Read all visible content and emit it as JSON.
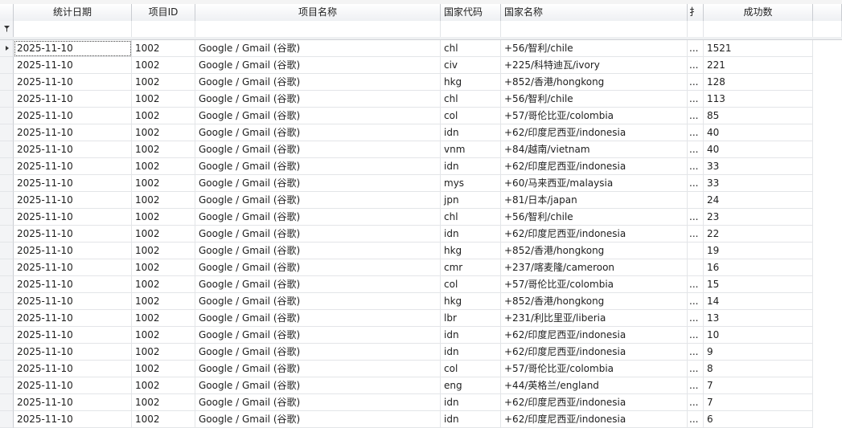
{
  "columns": [
    {
      "key": "date",
      "label": "统计日期"
    },
    {
      "key": "pid",
      "label": "项目ID"
    },
    {
      "key": "pname",
      "label": "项目名称"
    },
    {
      "key": "ccode",
      "label": "国家代码"
    },
    {
      "key": "cname",
      "label": "国家名称"
    },
    {
      "key": "trunc",
      "label": "扌"
    },
    {
      "key": "count",
      "label": "成功数"
    }
  ],
  "rows": [
    [
      "2025-11-10",
      "1002",
      "Google / Gmail (谷歌)",
      "chl",
      "+56/智利/chile",
      "...",
      "1521"
    ],
    [
      "2025-11-10",
      "1002",
      "Google / Gmail (谷歌)",
      "civ",
      "+225/科特迪瓦/ivory",
      "...",
      "221"
    ],
    [
      "2025-11-10",
      "1002",
      "Google / Gmail (谷歌)",
      "hkg",
      "+852/香港/hongkong",
      "...",
      "128"
    ],
    [
      "2025-11-10",
      "1002",
      "Google / Gmail (谷歌)",
      "chl",
      "+56/智利/chile",
      "...",
      "113"
    ],
    [
      "2025-11-10",
      "1002",
      "Google / Gmail (谷歌)",
      "col",
      "+57/哥伦比亚/colombia",
      "...",
      "85"
    ],
    [
      "2025-11-10",
      "1002",
      "Google / Gmail (谷歌)",
      "idn",
      "+62/印度尼西亚/indonesia",
      "...",
      "40"
    ],
    [
      "2025-11-10",
      "1002",
      "Google / Gmail (谷歌)",
      "vnm",
      "+84/越南/vietnam",
      "...",
      "40"
    ],
    [
      "2025-11-10",
      "1002",
      "Google / Gmail (谷歌)",
      "idn",
      "+62/印度尼西亚/indonesia",
      "...",
      "33"
    ],
    [
      "2025-11-10",
      "1002",
      "Google / Gmail (谷歌)",
      "mys",
      "+60/马来西亚/malaysia",
      "...",
      "33"
    ],
    [
      "2025-11-10",
      "1002",
      "Google / Gmail (谷歌)",
      "jpn",
      "+81/日本/japan",
      "",
      "24"
    ],
    [
      "2025-11-10",
      "1002",
      "Google / Gmail (谷歌)",
      "chl",
      "+56/智利/chile",
      "...",
      "23"
    ],
    [
      "2025-11-10",
      "1002",
      "Google / Gmail (谷歌)",
      "idn",
      "+62/印度尼西亚/indonesia",
      "...",
      "22"
    ],
    [
      "2025-11-10",
      "1002",
      "Google / Gmail (谷歌)",
      "hkg",
      "+852/香港/hongkong",
      "",
      "19"
    ],
    [
      "2025-11-10",
      "1002",
      "Google / Gmail (谷歌)",
      "cmr",
      "+237/喀麦隆/cameroon",
      "",
      "16"
    ],
    [
      "2025-11-10",
      "1002",
      "Google / Gmail (谷歌)",
      "col",
      "+57/哥伦比亚/colombia",
      "...",
      "15"
    ],
    [
      "2025-11-10",
      "1002",
      "Google / Gmail (谷歌)",
      "hkg",
      "+852/香港/hongkong",
      "...",
      "14"
    ],
    [
      "2025-11-10",
      "1002",
      "Google / Gmail (谷歌)",
      "lbr",
      "+231/利比里亚/liberia",
      "...",
      "13"
    ],
    [
      "2025-11-10",
      "1002",
      "Google / Gmail (谷歌)",
      "idn",
      "+62/印度尼西亚/indonesia",
      "...",
      "10"
    ],
    [
      "2025-11-10",
      "1002",
      "Google / Gmail (谷歌)",
      "idn",
      "+62/印度尼西亚/indonesia",
      "...",
      "9"
    ],
    [
      "2025-11-10",
      "1002",
      "Google / Gmail (谷歌)",
      "col",
      "+57/哥伦比亚/colombia",
      "...",
      "8"
    ],
    [
      "2025-11-10",
      "1002",
      "Google / Gmail (谷歌)",
      "eng",
      "+44/英格兰/england",
      "...",
      "7"
    ],
    [
      "2025-11-10",
      "1002",
      "Google / Gmail (谷歌)",
      "idn",
      "+62/印度尼西亚/indonesia",
      "...",
      "7"
    ],
    [
      "2025-11-10",
      "1002",
      "Google / Gmail (谷歌)",
      "idn",
      "+62/印度尼西亚/indonesia",
      "...",
      "6"
    ]
  ],
  "filter_icon": "filter-icon",
  "current_row_icon": "row-indicator-arrow-icon"
}
